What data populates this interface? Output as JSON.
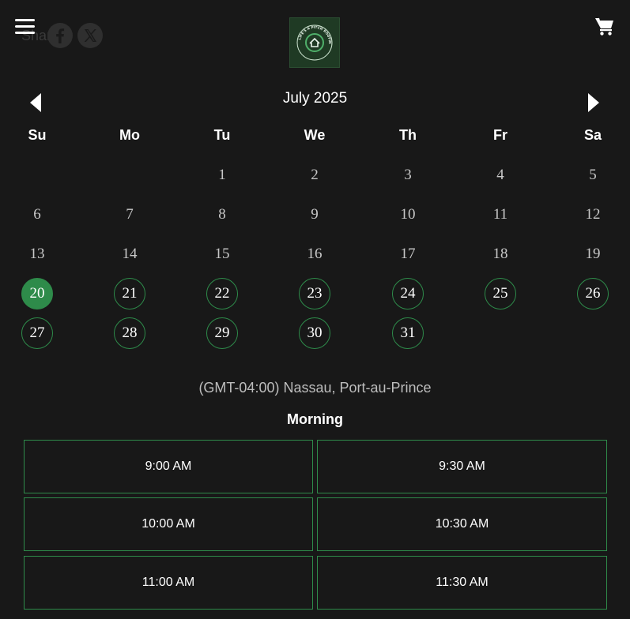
{
  "header": {
    "share_label": "Share:",
    "share_icons": [
      "facebook-icon",
      "x-twitter-icon"
    ],
    "menu_icon": "hamburger-menu-icon",
    "cart_icon": "shopping-cart-icon",
    "logo_text": "LIFE'S A PITCH ROOFING"
  },
  "calendar": {
    "month_label": "July 2025",
    "weekdays": [
      "Su",
      "Mo",
      "Tu",
      "We",
      "Th",
      "Fr",
      "Sa"
    ],
    "first_weekday_index": 2,
    "days_in_month": 31,
    "selected_day": 20,
    "available_from": 20,
    "available_days": [
      20,
      21,
      22,
      23,
      24,
      25,
      26,
      27,
      28,
      29,
      30,
      31
    ]
  },
  "timezone": "(GMT-04:00) Nassau, Port-au-Prince",
  "times": {
    "section_title": "Morning",
    "slots": [
      "9:00 AM",
      "9:30 AM",
      "10:00 AM",
      "10:30 AM",
      "11:00 AM",
      "11:30 AM"
    ]
  },
  "colors": {
    "background": "#181818",
    "accent": "#2e8b4a",
    "logo_bg": "#1f3a24"
  }
}
